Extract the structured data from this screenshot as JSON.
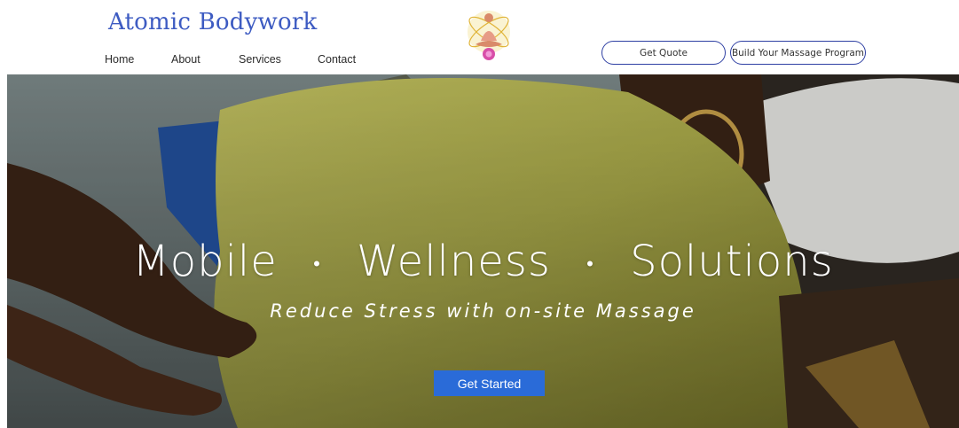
{
  "brand": {
    "name": "Atomic Bodywork"
  },
  "nav": {
    "items": [
      "Home",
      "About",
      "Services",
      "Contact"
    ]
  },
  "header_buttons": {
    "quote": "Get Quote",
    "program": "Build Your Massage Program"
  },
  "hero": {
    "words": [
      "Mobile",
      "Wellness",
      "Solutions"
    ],
    "separator": "•",
    "subtitle": "Reduce Stress with on-site Massage",
    "cta": "Get Started"
  },
  "colors": {
    "brand": "#3d5bc2",
    "button_border": "#2e3fa3",
    "cta": "#2a6bd8"
  },
  "icons": {
    "logo": "meditating-figure-atom-logo-icon"
  }
}
